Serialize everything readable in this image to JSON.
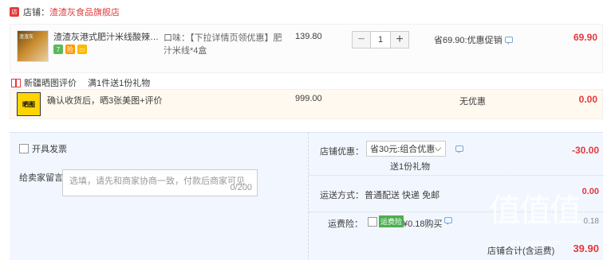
{
  "shop": {
    "icon": "shop-icon",
    "prefix": "店铺：",
    "name": "渣渣灰食品旗舰店"
  },
  "product": {
    "thumb_label": "渣渣灰",
    "name": "渣渣灰港式肥汁米线酸辣米粉酸...",
    "spec": "口味：【下拉详情页领优惠】肥汁米线*4盒",
    "price": "139.80",
    "quantity": "1",
    "promo": "省69.90:优惠促销",
    "subtotal": "69.90",
    "badges": [
      {
        "label": "7",
        "icon": "seven-day-return-icon",
        "color": "#5cb85c"
      },
      {
        "label": "险",
        "icon": "insurance-icon",
        "color": "#ff9800"
      },
      {
        "label": "▭",
        "icon": "card-icon",
        "color": "#fcb900"
      }
    ]
  },
  "gift": {
    "title": "新疆晒图评价",
    "subtitle": "满1件送1份礼物",
    "thumb_label": "晒图",
    "name": "确认收货后，晒3张美图+评价",
    "price": "999.00",
    "promo": "无优惠",
    "subtotal": "0.00"
  },
  "order": {
    "invoice_label": "开具发票",
    "message_label": "给卖家留言：",
    "message_placeholder": "选填，请先和商家协商一致，付款后商家可见",
    "message_count": "0/200",
    "discount_label": "店铺优惠：",
    "discount_select": "省30元:组合优惠",
    "discount_sub": "送1份礼物",
    "discount_amount": "-30.00",
    "shipping_label": "运送方式：",
    "shipping_method": "普通配送 快递 免邮",
    "shipping_amount": "0.00",
    "insurance_label": "运费险：",
    "insurance_badge": "运费险",
    "insurance_price": "¥0.18购买",
    "insurance_amount": "0.18",
    "total_label": "店铺合计(含运费)",
    "total_amount": "39.90"
  },
  "watermark": {
    "text": "值值值",
    "url": "zhi.smzdm.com"
  }
}
